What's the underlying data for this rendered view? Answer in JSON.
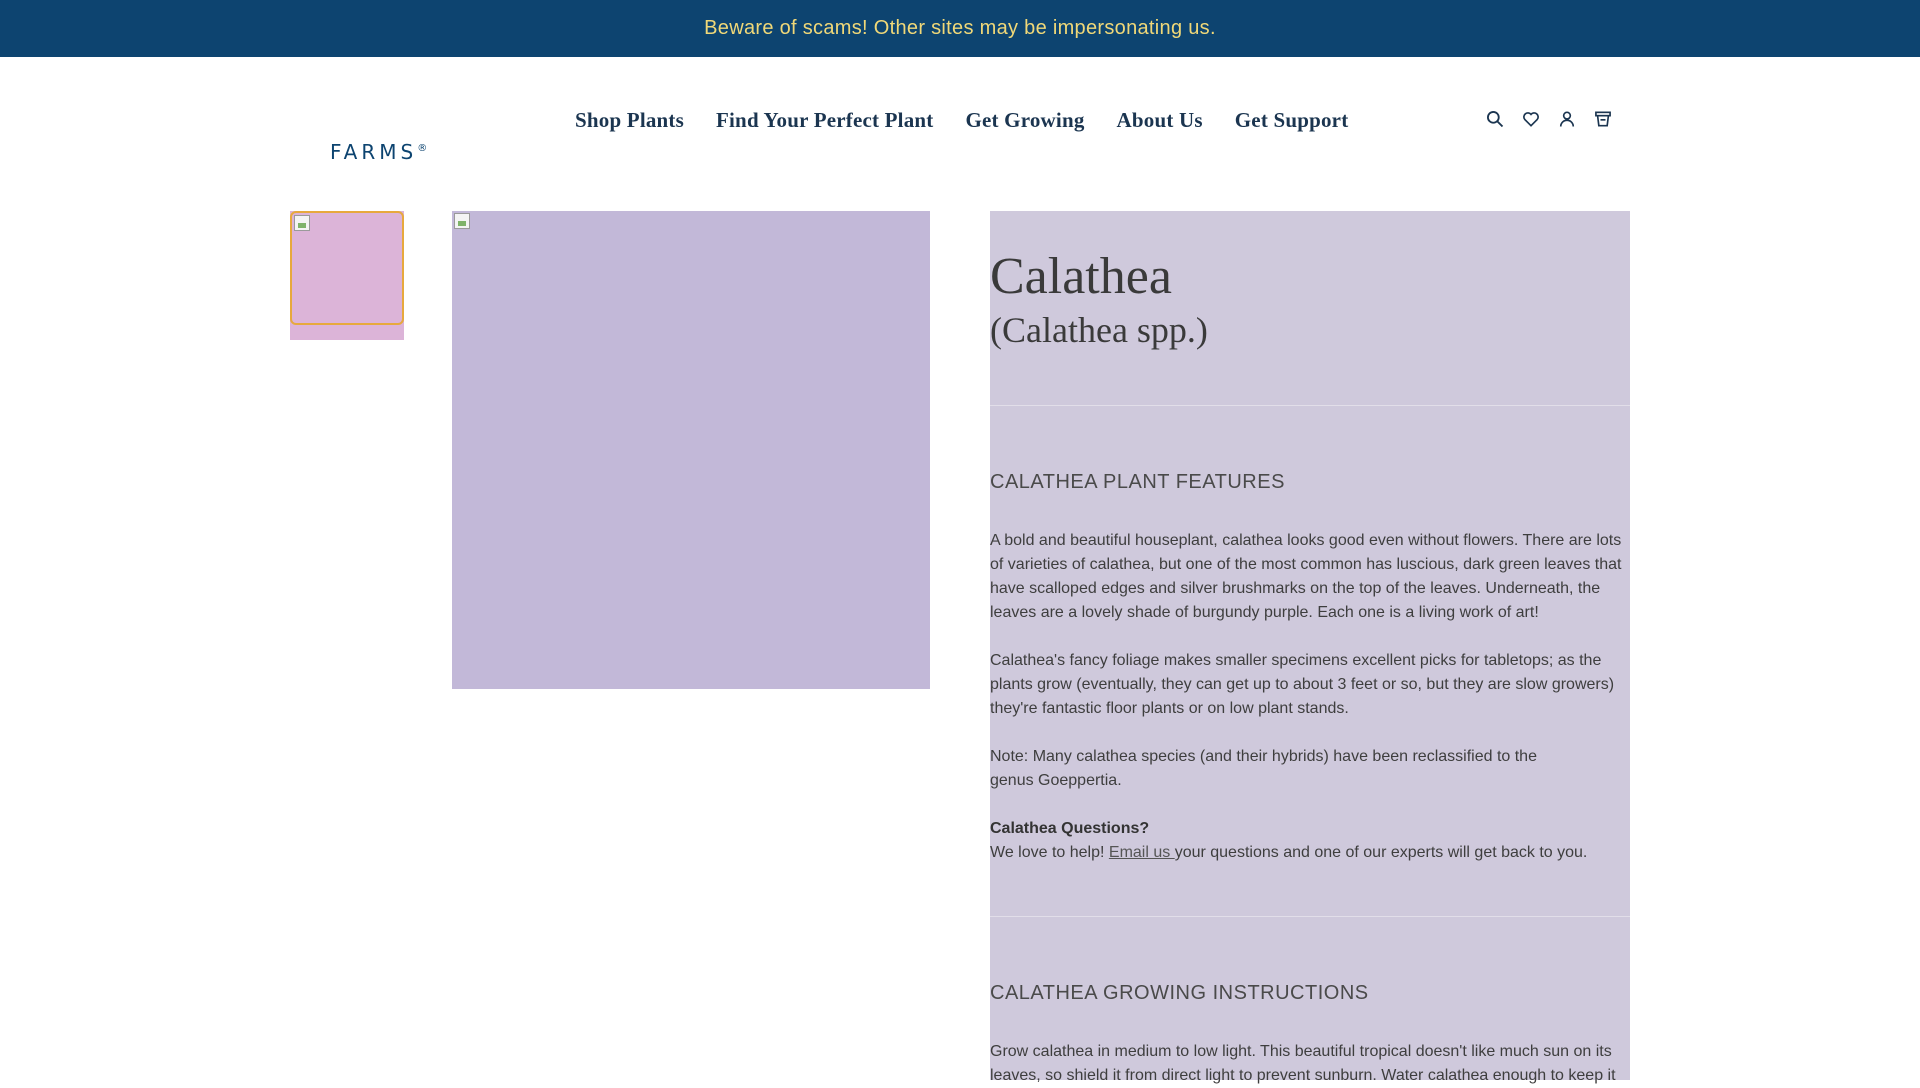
{
  "banner": {
    "text": "Beware of scams! Other sites may be impersonating us."
  },
  "logo": {
    "text": "FARMS",
    "trademark": "®"
  },
  "nav": {
    "items": [
      "Shop Plants",
      "Find Your Perfect Plant",
      "Get Growing",
      "About Us",
      "Get Support"
    ]
  },
  "header_icons": [
    "search-icon",
    "heart-icon",
    "account-icon",
    "cart-icon"
  ],
  "colors": {
    "banner_bg": "#0d4470",
    "banner_text": "#f0d878",
    "nav_text": "#1b3550",
    "thumbnail_border": "#e7a93d",
    "details_bg": "#cfc9dc"
  },
  "product": {
    "name": "Calathea",
    "botanical": "(Calathea spp.)",
    "features": {
      "heading": "Calathea Plant Features",
      "p1": "A bold and beautiful houseplant, calathea looks good even without flowers. There are lots of varieties of calathea, but one of the most common has luscious, dark green leaves that have scalloped edges and silver brushmarks on the top of the leaves. Underneath, the leaves are a lovely shade of burgundy purple. Each one is a living work of art!",
      "p2": "Calathea's fancy foliage makes smaller specimens excellent picks for tabletops; as the plants grow (eventually, they can get up to about 3 feet or so, but they are slow growers) they're fantastic floor plants or on low plant stands.",
      "p3_line1": "Note: Many calathea species (and their hybrids) have been reclassified to the",
      "p3_line2": "genus Goeppertia.",
      "questions_title": "Calathea Questions?",
      "help_before": "We love to help! ",
      "email_link": "Email us ",
      "help_after": "your questions and one of our experts will get back to you."
    },
    "growing": {
      "heading": "Calathea Growing Instructions",
      "p1": "Grow calathea in medium to low light. This beautiful tropical doesn't like much sun on its leaves, so shield it from direct light to prevent sunburn. Water calathea enough to keep it"
    }
  }
}
